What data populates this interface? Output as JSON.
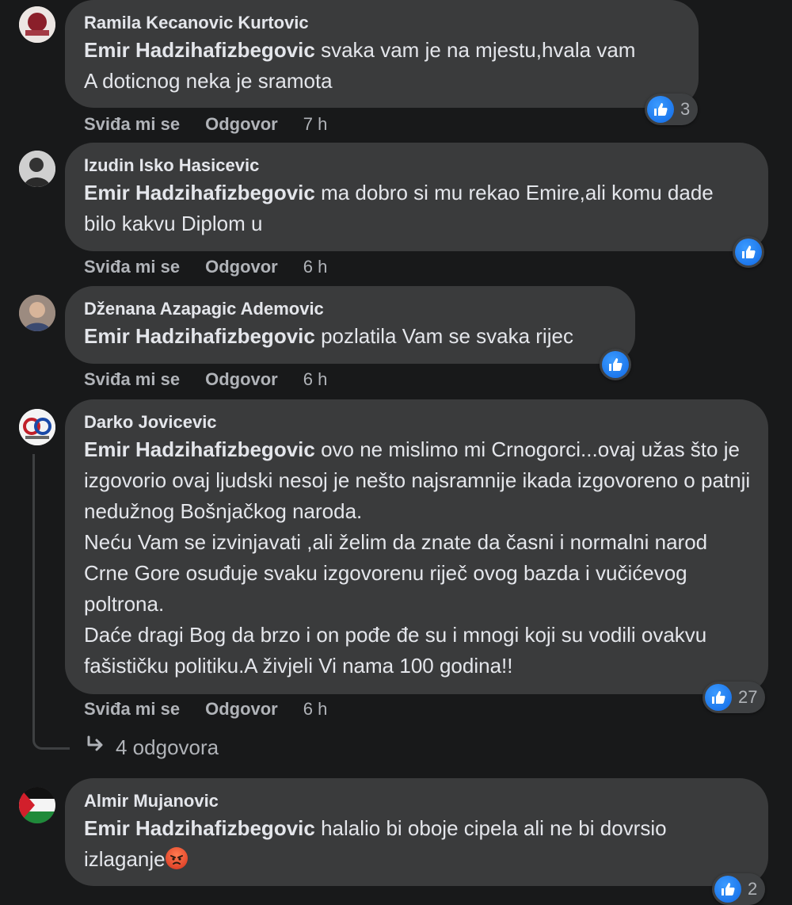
{
  "comments": [
    {
      "author": "Ramila Kecanovic Kurtovic",
      "mention": "Emir Hadzihafizbegovic",
      "text": "svaka vam je na mjestu,hvala vam",
      "text2": "A doticnog neka je sramota",
      "like_label": "Sviđa mi se",
      "reply_label": "Odgovor",
      "time": "7 h",
      "reaction_count": "3"
    },
    {
      "author": "Izudin Isko Hasicevic",
      "mention": "Emir Hadzihafizbegovic",
      "text": "ma dobro si mu rekao Emire,ali komu dade bilo kakvu Diplom u",
      "like_label": "Sviđa mi se",
      "reply_label": "Odgovor",
      "time": "6 h",
      "reaction_count": ""
    },
    {
      "author": "Dženana Azapagic Ademovic",
      "mention": "Emir Hadzihafizbegovic",
      "text": "pozlatila Vam se svaka rijec",
      "like_label": "Sviđa mi se",
      "reply_label": "Odgovor",
      "time": "6 h",
      "reaction_count": ""
    },
    {
      "author": "Darko Jovicevic",
      "mention": "Emir Hadzihafizbegovic",
      "text": "ovo ne mislimo mi Crnogorci...ovaj užas što je izgovorio ovaj ljudski nesoj je nešto najsramnije ikada izgovoreno o patnji nedužnog Bošnjačkog naroda.",
      "text2": "Neću Vam se izvinjavati ,ali želim da znate da časni i normalni narod Crne Gore osuđuje svaku izgovorenu riječ ovog bazda i vučićevog poltrona.",
      "text3": "Daće dragi Bog da brzo i on pođe đe su i mnogi koji su vodili ovakvu fašističku politiku.A živjeli Vi nama 100 godina!!",
      "like_label": "Sviđa mi se",
      "reply_label": "Odgovor",
      "time": "6 h",
      "reaction_count": "27",
      "replies_label": "4 odgovora"
    },
    {
      "author": "Almir Mujanovic",
      "mention": "Emir Hadzihafizbegovic",
      "text": "halalio bi oboje cipela ali ne bi dovrsio izlaganje",
      "reaction_count": "2"
    }
  ],
  "icons": {
    "like": "thumbs-up-icon",
    "reply_arrow": "reply-arrow-icon",
    "angry_emoji": "angry-face-emoji"
  },
  "colors": {
    "background": "#18191a",
    "bubble": "#3a3b3c",
    "like_blue": "#1877f2",
    "secondary_text": "#b0b3b8"
  }
}
